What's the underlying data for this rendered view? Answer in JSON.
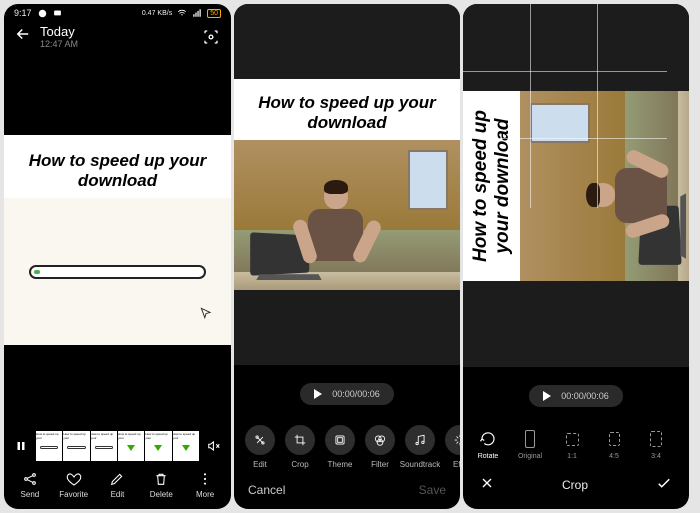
{
  "screen1": {
    "status": {
      "time": "9:17",
      "network": "0.47 KB/s",
      "battery": "50"
    },
    "header": {
      "title": "Today",
      "subtitle": "12:47 AM"
    },
    "content": {
      "title": "How to speed up your download"
    },
    "thumb_label": "How to speed up your",
    "bottom": {
      "send": "Send",
      "favorite": "Favorite",
      "edit": "Edit",
      "delete": "Delete",
      "more": "More"
    }
  },
  "screen2": {
    "content": {
      "title": "How to speed up your download"
    },
    "time": "00:00/00:06",
    "tools": {
      "edit": "Edit",
      "crop": "Crop",
      "theme": "Theme",
      "filter": "Filter",
      "soundtrack": "Soundtrack",
      "effect": "Effe"
    },
    "bar": {
      "cancel": "Cancel",
      "save": "Save"
    }
  },
  "screen3": {
    "content": {
      "title": "How to speed up your download"
    },
    "time": "00:00/00:06",
    "options": {
      "rotate": "Rotate",
      "original": "Original",
      "r11": "1:1",
      "r45": "4:5",
      "r34": "3:4"
    },
    "bar_title": "Crop"
  }
}
